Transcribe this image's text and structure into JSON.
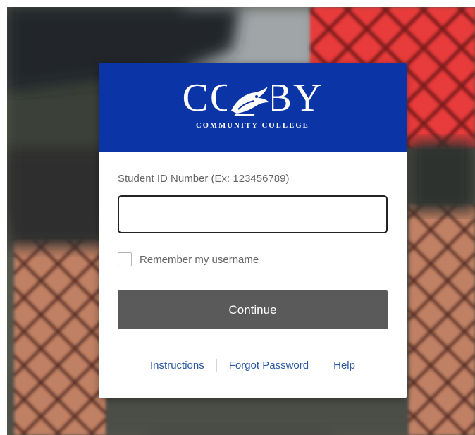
{
  "brand": {
    "logo_word": "COLBY",
    "logo_subtitle": "COMMUNITY COLLEGE",
    "header_color": "#0b35a6"
  },
  "login": {
    "field_label": "Student ID Number (Ex: 123456789)",
    "username_value": "",
    "remember_label": "Remember my username",
    "remember_checked": false,
    "continue_label": "Continue"
  },
  "links": {
    "instructions": "Instructions",
    "forgot_password": "Forgot Password",
    "help": "Help"
  },
  "icons": {
    "logo_mark": "trojan-helmet-icon",
    "checkbox": "checkbox-unchecked-icon"
  },
  "colors": {
    "button": "#5a5a5a",
    "link": "#2b5aa3",
    "label": "#666666"
  }
}
